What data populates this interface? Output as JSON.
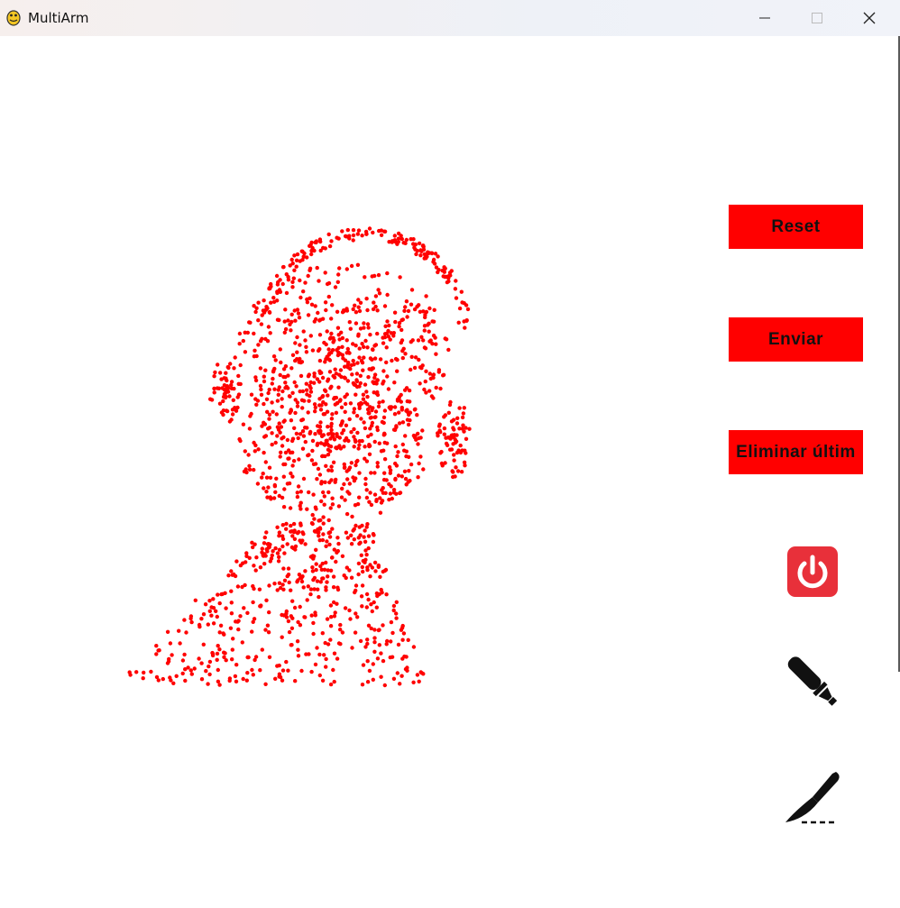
{
  "window": {
    "title": "MultiArm",
    "icon": "python-icon",
    "controls": [
      "minimize-icon",
      "maximize-icon",
      "close-icon"
    ]
  },
  "buttons": {
    "reset": "Reset",
    "enviar": "Enviar",
    "eliminar": "Eliminar últim"
  },
  "tools": {
    "power": "power-icon",
    "marker": "marker-icon",
    "scalpel": "scalpel-icon"
  },
  "colors": {
    "points": "#ff0000",
    "button": "#ff0000",
    "power_button": "#e8303a"
  },
  "pointcloud": {
    "subject": "head-and-shoulders point cloud",
    "point_color": "#ff0000"
  }
}
